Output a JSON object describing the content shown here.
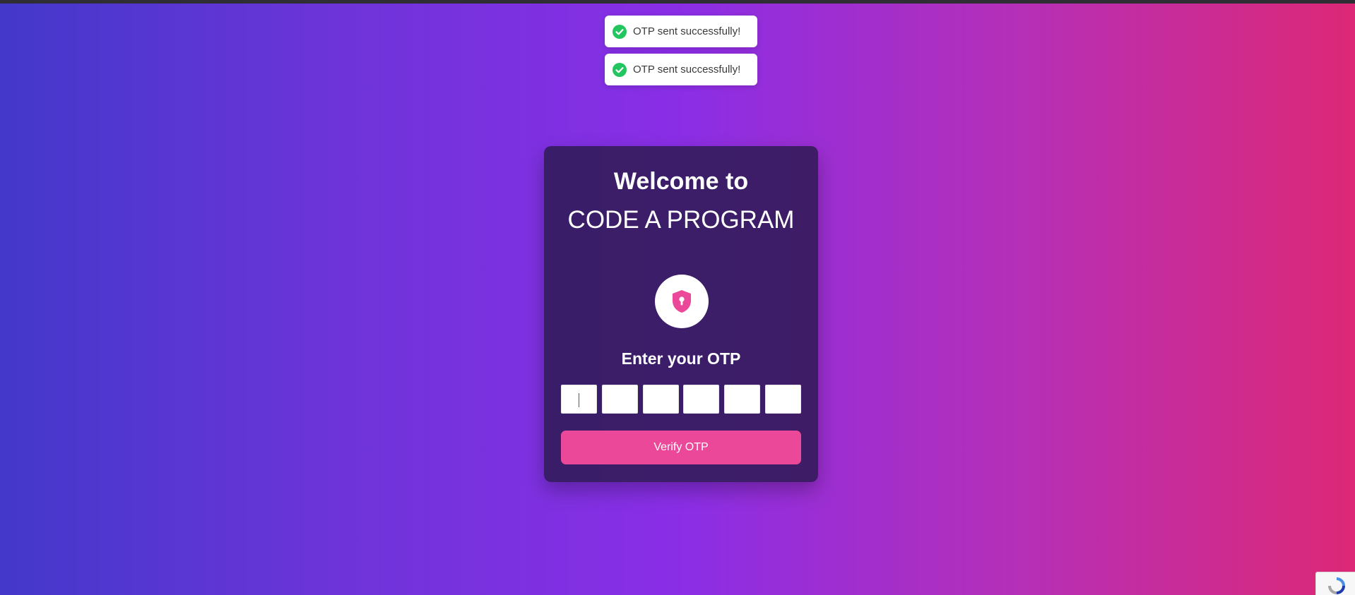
{
  "toasts": [
    {
      "message": "OTP sent successfully!",
      "icon": "check-circle-icon",
      "color": "#22c55e"
    },
    {
      "message": "OTP sent successfully!",
      "icon": "check-circle-icon",
      "color": "#22c55e"
    }
  ],
  "card": {
    "welcome": "Welcome to",
    "brand": "CODE A PROGRAM",
    "icon": "shield-lock-icon",
    "otp_label": "Enter your OTP",
    "otp_fields": [
      "",
      "",
      "",
      "",
      "",
      ""
    ],
    "verify_label": "Verify OTP"
  },
  "recaptcha": {
    "icon": "recaptcha-icon"
  },
  "colors": {
    "accent": "#ec4899",
    "gradient_start": "#4338ca",
    "gradient_mid": "#8a2ee6",
    "gradient_end": "#dc2876",
    "card_bg": "#2f1b54",
    "success": "#22c55e"
  }
}
